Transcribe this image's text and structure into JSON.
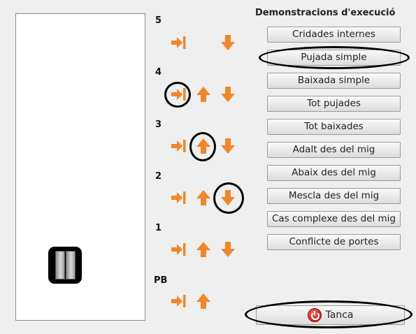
{
  "shaft": {
    "floors": [
      "5",
      "4",
      "3",
      "2",
      "1",
      "PB"
    ]
  },
  "panel": {
    "title": "Demonstracions d'execució",
    "buttons": [
      "Cridades internes",
      "Pujada simple",
      "Baixada simple",
      "Tot pujades",
      "Tot baixades",
      "Adalt des del mig",
      "Abaix des del mig",
      "Mescla des del mig",
      "Cas complexe des del mig",
      "Conflicte de portes"
    ],
    "close_label": "Tanca"
  },
  "icons": {
    "cabin_call": "arrow-to-bar-icon",
    "up": "up-arrow-icon",
    "down": "down-arrow-icon",
    "close": "power-icon"
  },
  "colors": {
    "arrow_orange": "#f0862a",
    "highlight": "#000000",
    "power_red": "#d9342a"
  }
}
